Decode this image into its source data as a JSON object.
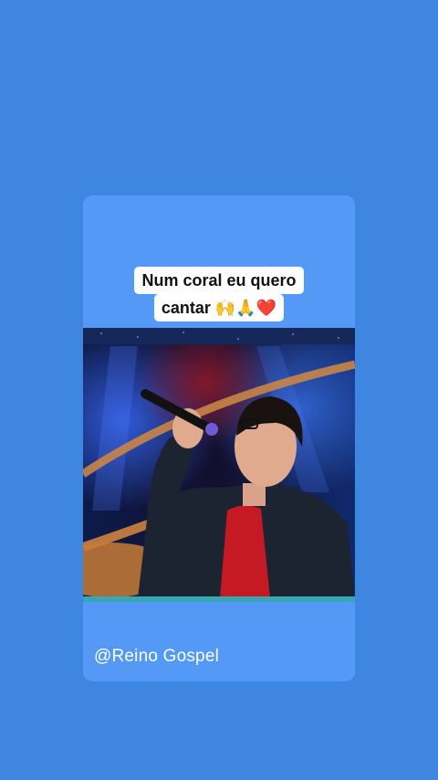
{
  "post": {
    "caption_line1": "Num coral eu quero",
    "caption_line2": "cantar 🙌🙏❤️",
    "handle": "@Reino Gospel"
  },
  "video": {
    "subject": "man-singing-with-microphone"
  },
  "colors": {
    "page_background": "#3f86e0",
    "card_background": "#5399f5",
    "caption_box": "#ffffff"
  }
}
